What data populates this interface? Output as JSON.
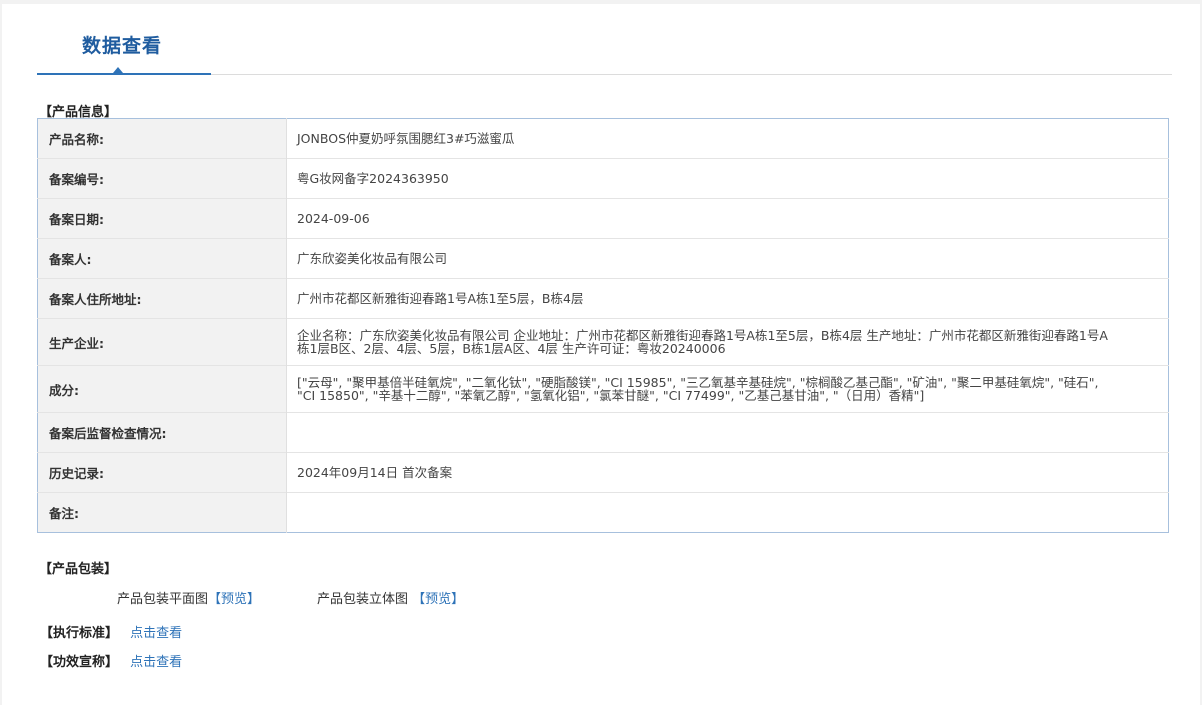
{
  "tab": {
    "title": "数据查看"
  },
  "sections": {
    "product_info": "【产品信息】",
    "packaging": "【产品包装】",
    "standard": "【执行标准】",
    "efficacy": "【功效宣称】"
  },
  "product_rows": [
    {
      "label": "产品名称:",
      "value": "JONBOS仲夏奶呼氛围腮红3#巧滋蜜瓜"
    },
    {
      "label": "备案编号:",
      "value": "粤G妆网备字2024363950"
    },
    {
      "label": "备案日期:",
      "value": "2024-09-06"
    },
    {
      "label": "备案人:",
      "value": "广东欣姿美化妆品有限公司"
    },
    {
      "label": "备案人住所地址:",
      "value": "广州市花都区新雅街迎春路1号A栋1至5层，B栋4层"
    },
    {
      "label": "生产企业:",
      "value": "企业名称：广东欣姿美化妆品有限公司 企业地址：广州市花都区新雅街迎春路1号A栋1至5层，B栋4层 生产地址：广州市花都区新雅街迎春路1号A栋1层B区、2层、4层、5层，B栋1层A区、4层 生产许可证：粤妆20240006"
    },
    {
      "label": "成分:",
      "value": "[\"云母\", \"聚甲基倍半硅氧烷\", \"二氧化钛\", \"硬脂酸镁\", \"CI 15985\", \"三乙氧基辛基硅烷\", \"棕榈酸乙基己酯\", \"矿油\", \"聚二甲基硅氧烷\", \"硅石\", \"CI 15850\", \"辛基十二醇\", \"苯氧乙醇\", \"氢氧化铝\", \"氯苯甘醚\", \"CI 77499\", \"乙基己基甘油\", \"（日用）香精\"]"
    },
    {
      "label": "备案后监督检查情况:",
      "value": ""
    },
    {
      "label": "历史记录:",
      "value": "2024年09月14日 首次备案"
    },
    {
      "label": "备注:",
      "value": ""
    }
  ],
  "packaging": {
    "flat_label": "产品包装平面图",
    "flat_link": "【预览】",
    "solid_label": "产品包装立体图",
    "solid_link": "【预览】"
  },
  "links": {
    "standard_link": "点击查看",
    "efficacy_link": "点击查看"
  },
  "colors": {
    "accent": "#2e73b8",
    "title": "#1f5c9f",
    "table_border": "#a7c0dd",
    "label_bg": "#f2f2f2"
  }
}
